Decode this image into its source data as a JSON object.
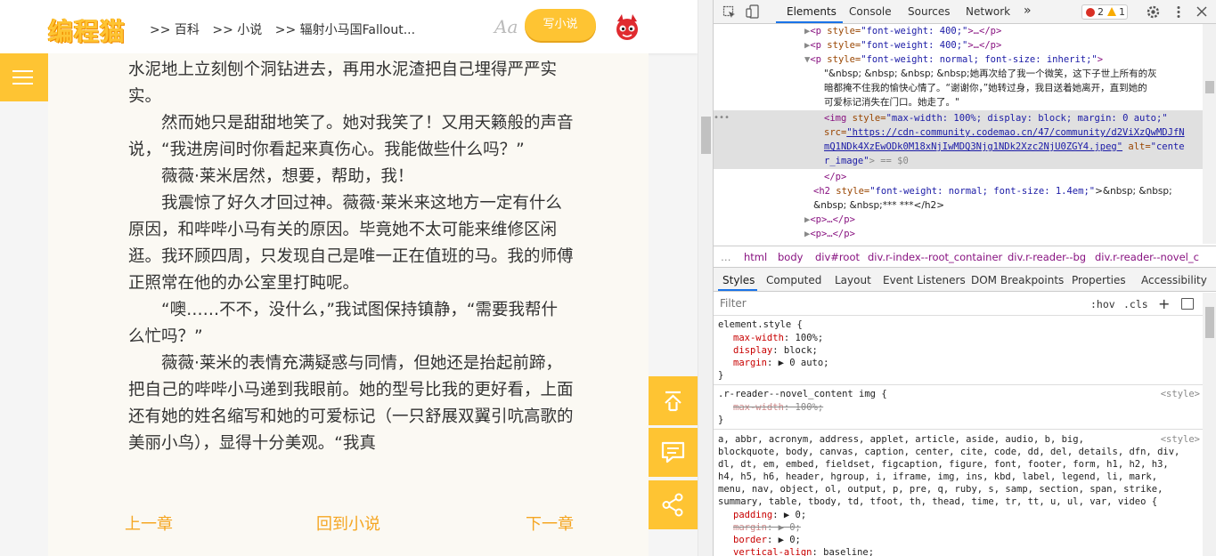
{
  "header": {
    "logo": "编程猫",
    "breadcrumb": [
      ">> 百科",
      ">> 小说",
      ">> 辐射小马国Fallout..."
    ],
    "font_toggle": "Aa",
    "write_button": "写小说"
  },
  "reader": {
    "paragraphs": [
      {
        "indent": false,
        "text": "水泥地上立刻刨个洞钻进去，再用水泥渣把自己埋得严严实实。"
      },
      {
        "indent": true,
        "text": "然而她只是甜甜地笑了。她对我笑了！又用天籁般的声音说，“我进房间时你看起来真伤心。我能做些什么吗？”"
      },
      {
        "indent": true,
        "text": "薇薇·莱米居然，想要，帮助，我！"
      },
      {
        "indent": true,
        "text": "我震惊了好久才回过神。薇薇·莱米来这地方一定有什么原因，和哔哔小马有关的原因。毕竟她不太可能来维修区闲逛。我环顾四周，只发现自己是唯一正在值班的马。我的师傅正照常在他的办公室里打盹呢。"
      },
      {
        "indent": true,
        "text": "“噢……不不，没什么，”我试图保持镇静，“需要我帮什么忙吗？”"
      },
      {
        "indent": true,
        "text": "薇薇·莱米的表情充满疑惑与同情，但她还是抬起前蹄，把自己的哔哔小马递到我眼前。她的型号比我的更好看，上面还有她的姓名缩写和她的可爱标记（一只舒展双翼引吭高歌的美丽小鸟），显得十分美观。“我真"
      }
    ],
    "nav": {
      "prev": "上一章",
      "back": "回到小说",
      "next": "下一章"
    }
  },
  "devtools": {
    "tabs": [
      "Elements",
      "Console",
      "Sources",
      "Network",
      "»"
    ],
    "errors": "2",
    "warnings": "1",
    "dom_lines": {
      "l1_tag": "<p",
      "l1_attr": " style=",
      "l1_val": "\"font-weight: 400;\"",
      "l1_rest": ">…</p>",
      "l2_tag": "<p",
      "l2_attr": " style=",
      "l2_val": "\"font-weight: 400;\"",
      "l2_rest": ">…</p>",
      "l3_tag": "<p",
      "l3_attr": " style=",
      "l3_val": "\"font-weight: normal; font-size: inherit;\"",
      "l3_rest": ">",
      "l4_text": "\"&nbsp; &nbsp; &nbsp; &nbsp;她再次给了我一个微笑，这下子世上所有的灰",
      "l5_text": "暗都掩不住我的愉快心情了。“谢谢你，”她转过身，我目送着她离开，直到她的",
      "l6_text": "可爱标记消失在门口。她走了。\"",
      "l7_tag": "<img",
      "l7_attr": " style=",
      "l7_val": "\"max-width: 100%; display: block; margin: 0 auto;\"",
      "l8_attr": "src=",
      "l8_link": "\"https://cdn-community.codemao.cn/47/community/d2ViXzQwMDJfN",
      "l9_link": "mQ1NDk4XzEwODk0M18xNjIwMDQ3Njg1NDk2Xzc2NjU0ZGY4.jpeg\"",
      "l9_attr": " alt=",
      "l9_val": "\"cente",
      "l10_val": "r_image\"",
      "l10_rest": "> == $0",
      "l11": "</p>",
      "l12_tag": "<h2",
      "l12_attr": " style=",
      "l12_val": "\"font-weight: normal; font-size: 1.4em;\"",
      "l12_text": ">&nbsp; &nbsp;",
      "l13_text": "&nbsp; &nbsp;*** ***</h2>",
      "l14": "<p>…</p>",
      "l15": "<p>…</p>"
    },
    "breadcrumbs": [
      "html",
      "body",
      "div#root",
      "div.r-index--root_container",
      "div.r-reader--bg",
      "div.r-reader--novel_c"
    ],
    "subtabs": [
      "Styles",
      "Computed",
      "Layout",
      "Event Listeners",
      "DOM Breakpoints",
      "Properties",
      "Accessibility"
    ],
    "filter_placeholder": "Filter",
    "hov": ":hov",
    "cls": ".cls",
    "plus": "+",
    "styles": {
      "r1_selector": "element.style {",
      "r1_p1": "max-width",
      "r1_v1": ": 100%;",
      "r1_p2": "display",
      "r1_v2": ": block;",
      "r1_p3": "margin",
      "r1_v3": ": ▶ 0 auto;",
      "close": "}",
      "r2_selector": ".r-reader--novel_content img {",
      "r2_source": "<style>",
      "r2_p1": "max-width",
      "r2_v1": ": 100%;",
      "r3_selector_1": "a, abbr, acronym, address, applet, article, aside, audio, b, big,",
      "r3_source": "<style>",
      "r3_selector_2": "blockquote, body, canvas, caption, center, cite, code, dd, del, details, dfn, div,",
      "r3_selector_3": "dl, dt, em, embed, fieldset, figcaption, figure, font, footer, form, h1, h2, h3,",
      "r3_selector_4": "h4, h5, h6, header, hgroup, i, iframe, img, ins, kbd, label, legend, li, mark,",
      "r3_selector_5": "menu, nav, object, ol, output, p, pre, q, ruby, s, samp, section, span, strike,",
      "r3_selector_6": "summary, table, tbody, td, tfoot, th, thead, time, tr, tt, u, ul, var, video {",
      "r3_p1": "padding",
      "r3_v1": ": ▶ 0;",
      "r3_p2": "margin",
      "r3_v2": ": ▶ 0;",
      "r3_p3": "border",
      "r3_v3": ": ▶ 0;",
      "r3_p4": "vertical-align",
      "r3_v4": ": baseline;"
    }
  },
  "colors": {
    "accent": "#fec433",
    "nav_text": "#f5a623",
    "reader_bg": "#fbf9f3",
    "devtools_blue": "#1a73e8"
  }
}
